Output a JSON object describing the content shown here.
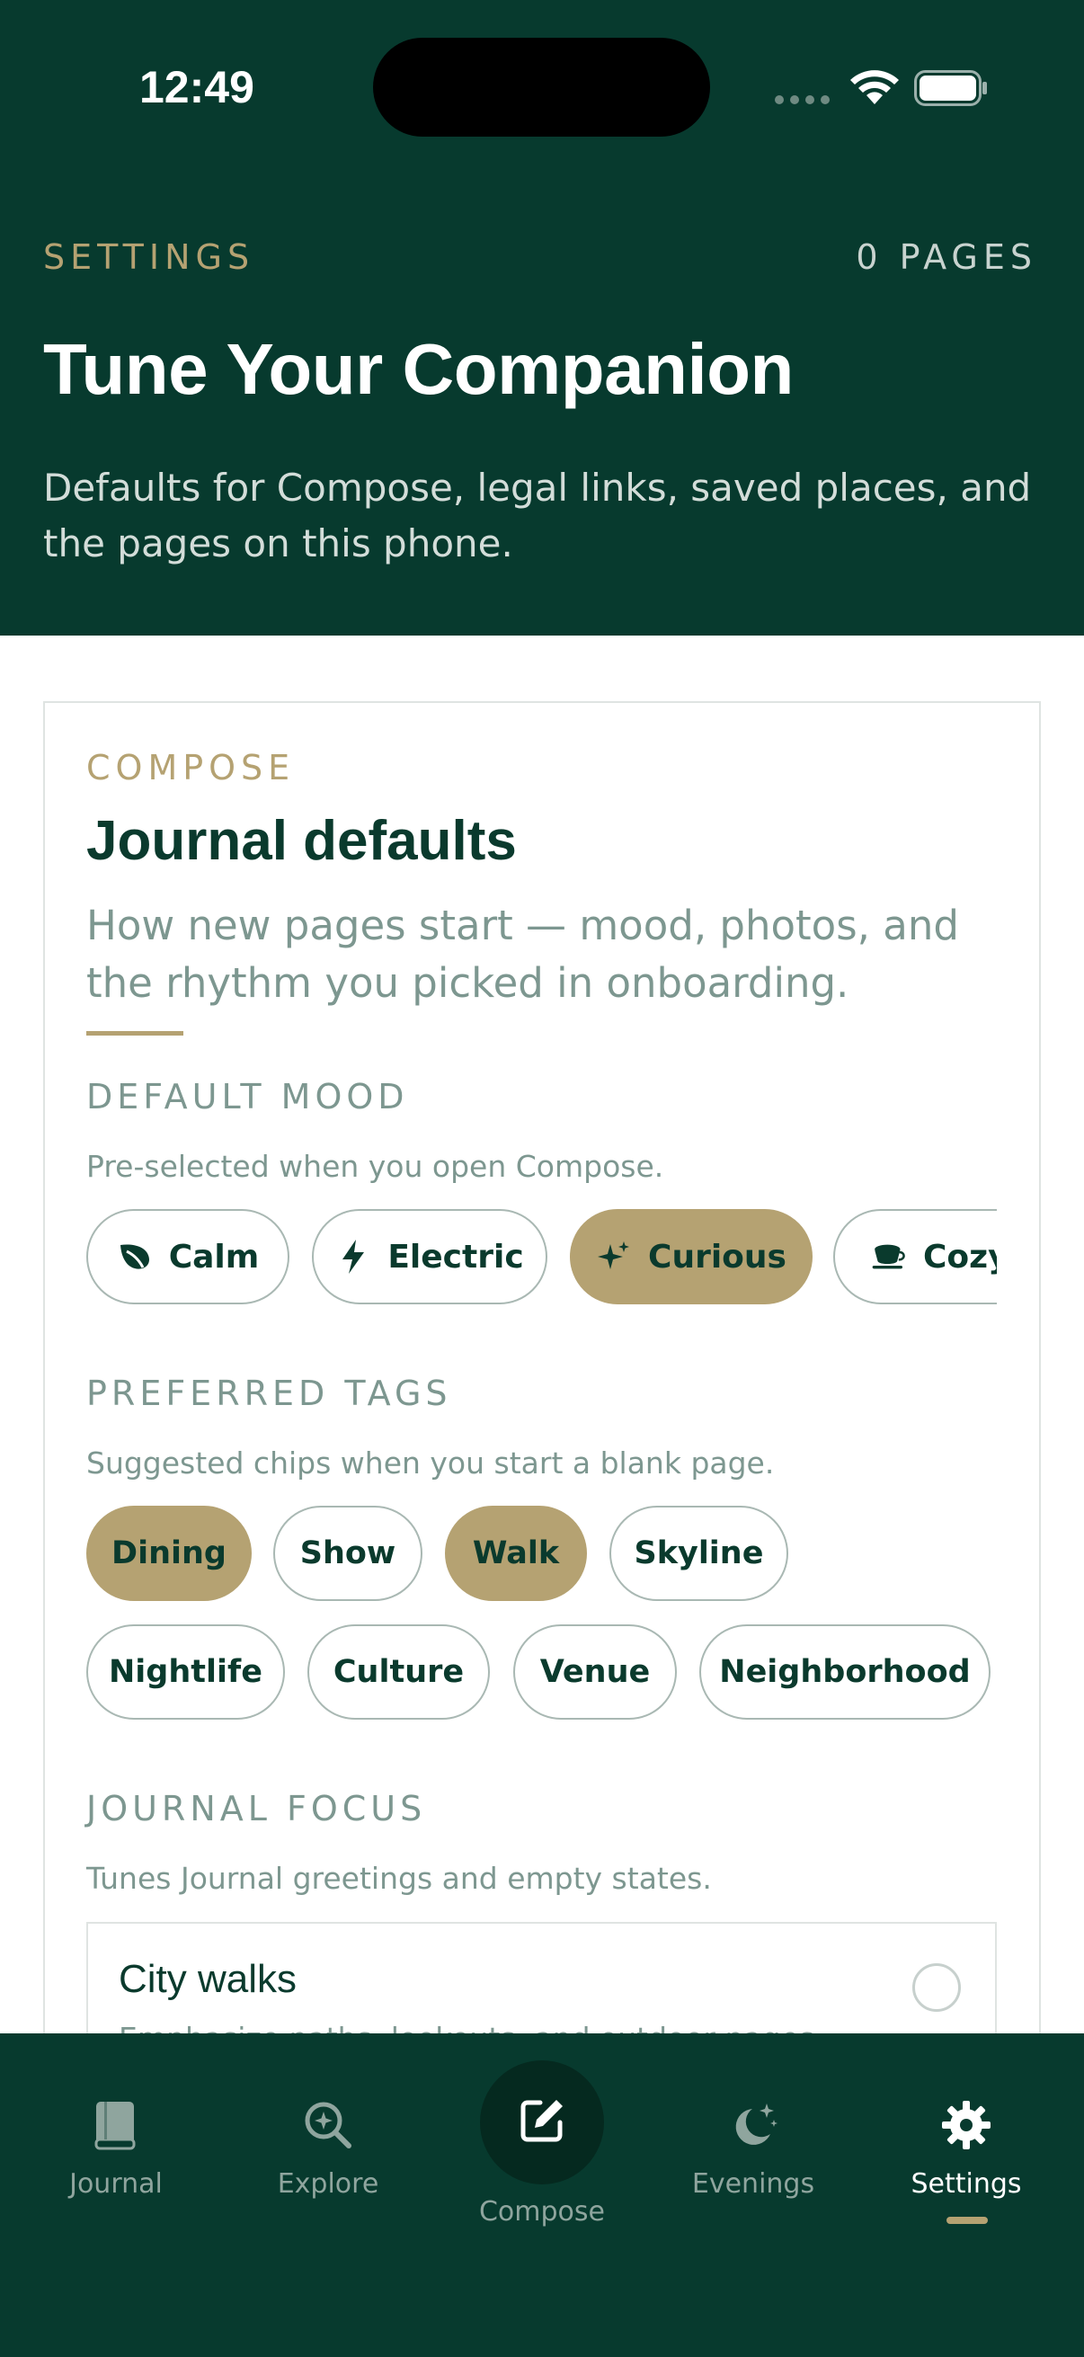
{
  "status_bar": {
    "time": "12:49"
  },
  "header": {
    "eyebrow": "SETTINGS",
    "page_count": "0 PAGES",
    "title": "Tune Your Companion",
    "subtitle": "Defaults for Compose, legal links, saved places, and the pages on this phone."
  },
  "card": {
    "eyebrow": "COMPOSE",
    "title": "Journal defaults",
    "subtitle": "How new pages start — mood, photos, and the rhythm you picked in onboarding.",
    "default_mood": {
      "label": "DEFAULT MOOD",
      "help": "Pre-selected when you open Compose.",
      "options": [
        {
          "label": "Calm",
          "icon": "leaf-icon",
          "selected": false
        },
        {
          "label": "Electric",
          "icon": "bolt-icon",
          "selected": false
        },
        {
          "label": "Curious",
          "icon": "sparkle-icon",
          "selected": true
        },
        {
          "label": "Cozy",
          "icon": "cup-icon",
          "selected": false
        }
      ]
    },
    "preferred_tags": {
      "label": "PREFERRED TAGS",
      "help": "Suggested chips when you start a blank page.",
      "tags": [
        {
          "label": "Dining",
          "selected": true
        },
        {
          "label": "Show",
          "selected": false
        },
        {
          "label": "Walk",
          "selected": true
        },
        {
          "label": "Skyline",
          "selected": false
        },
        {
          "label": "Nightlife",
          "selected": false
        },
        {
          "label": "Culture",
          "selected": false
        },
        {
          "label": "Venue",
          "selected": false
        },
        {
          "label": "Neighborhood",
          "selected": false
        }
      ]
    },
    "journal_focus": {
      "label": "JOURNAL FOCUS",
      "help": "Tunes Journal greetings and empty states.",
      "options": [
        {
          "title": "City walks",
          "description": "Emphasize paths, lookouts, and outdoor pages.",
          "selected": false
        }
      ]
    }
  },
  "tabbar": {
    "items": [
      {
        "label": "Journal",
        "icon": "book-icon",
        "active": false
      },
      {
        "label": "Explore",
        "icon": "explore-search-icon",
        "active": false
      },
      {
        "label": "Compose",
        "icon": "compose-edit-icon",
        "active": false
      },
      {
        "label": "Evenings",
        "icon": "moon-stars-icon",
        "active": false
      },
      {
        "label": "Settings",
        "icon": "gear-icon",
        "active": true
      }
    ]
  },
  "colors": {
    "brand_green": "#073a2e",
    "gold_accent": "#b5a272",
    "muted_text": "#7d9790",
    "ink": "#0a3a2d"
  }
}
